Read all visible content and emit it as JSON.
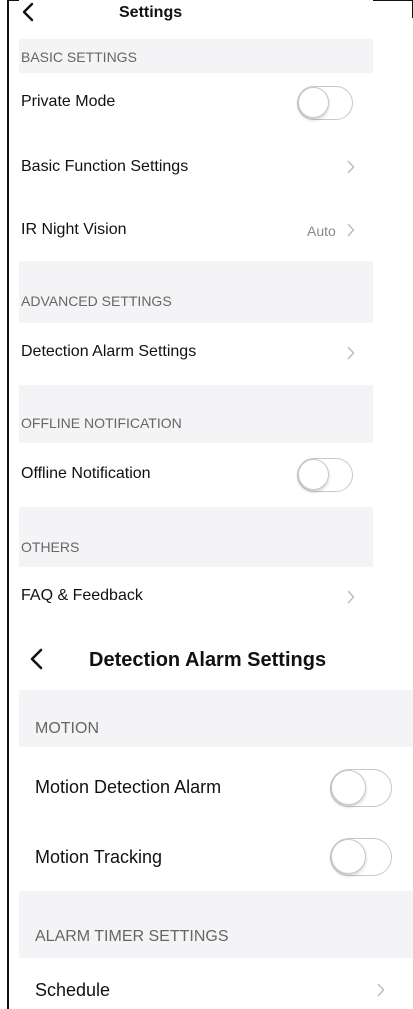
{
  "screen1": {
    "title": "Settings",
    "sections": {
      "basic": "BASIC SETTINGS",
      "advanced": "ADVANCED SETTINGS",
      "offline": "OFFLINE NOTIFICATION",
      "others": "OTHERS"
    },
    "rows": {
      "private_mode": "Private Mode",
      "basic_function": "Basic Function Settings",
      "ir_night_vision": "IR Night Vision",
      "ir_value": "Auto",
      "detection_alarm": "Detection Alarm Settings",
      "offline_notification": "Offline Notification",
      "faq": "FAQ & Feedback"
    }
  },
  "screen2": {
    "title": "Detection Alarm Settings",
    "sections": {
      "motion": "MOTION",
      "timer": "ALARM TIMER SETTINGS"
    },
    "rows": {
      "motion_detection": "Motion Detection Alarm",
      "motion_tracking": "Motion Tracking",
      "schedule": "Schedule"
    }
  },
  "toggles": {
    "private_mode": false,
    "offline_notification": false,
    "motion_detection": false,
    "motion_tracking": false
  },
  "icons": [
    "back-chevron-icon",
    "chevron-right-icon"
  ],
  "colors": {
    "section_bg": "#f4f4f6",
    "section_text": "#666666",
    "toggle_border": "#c8c8cc",
    "chevron": "#c0c0c4"
  }
}
